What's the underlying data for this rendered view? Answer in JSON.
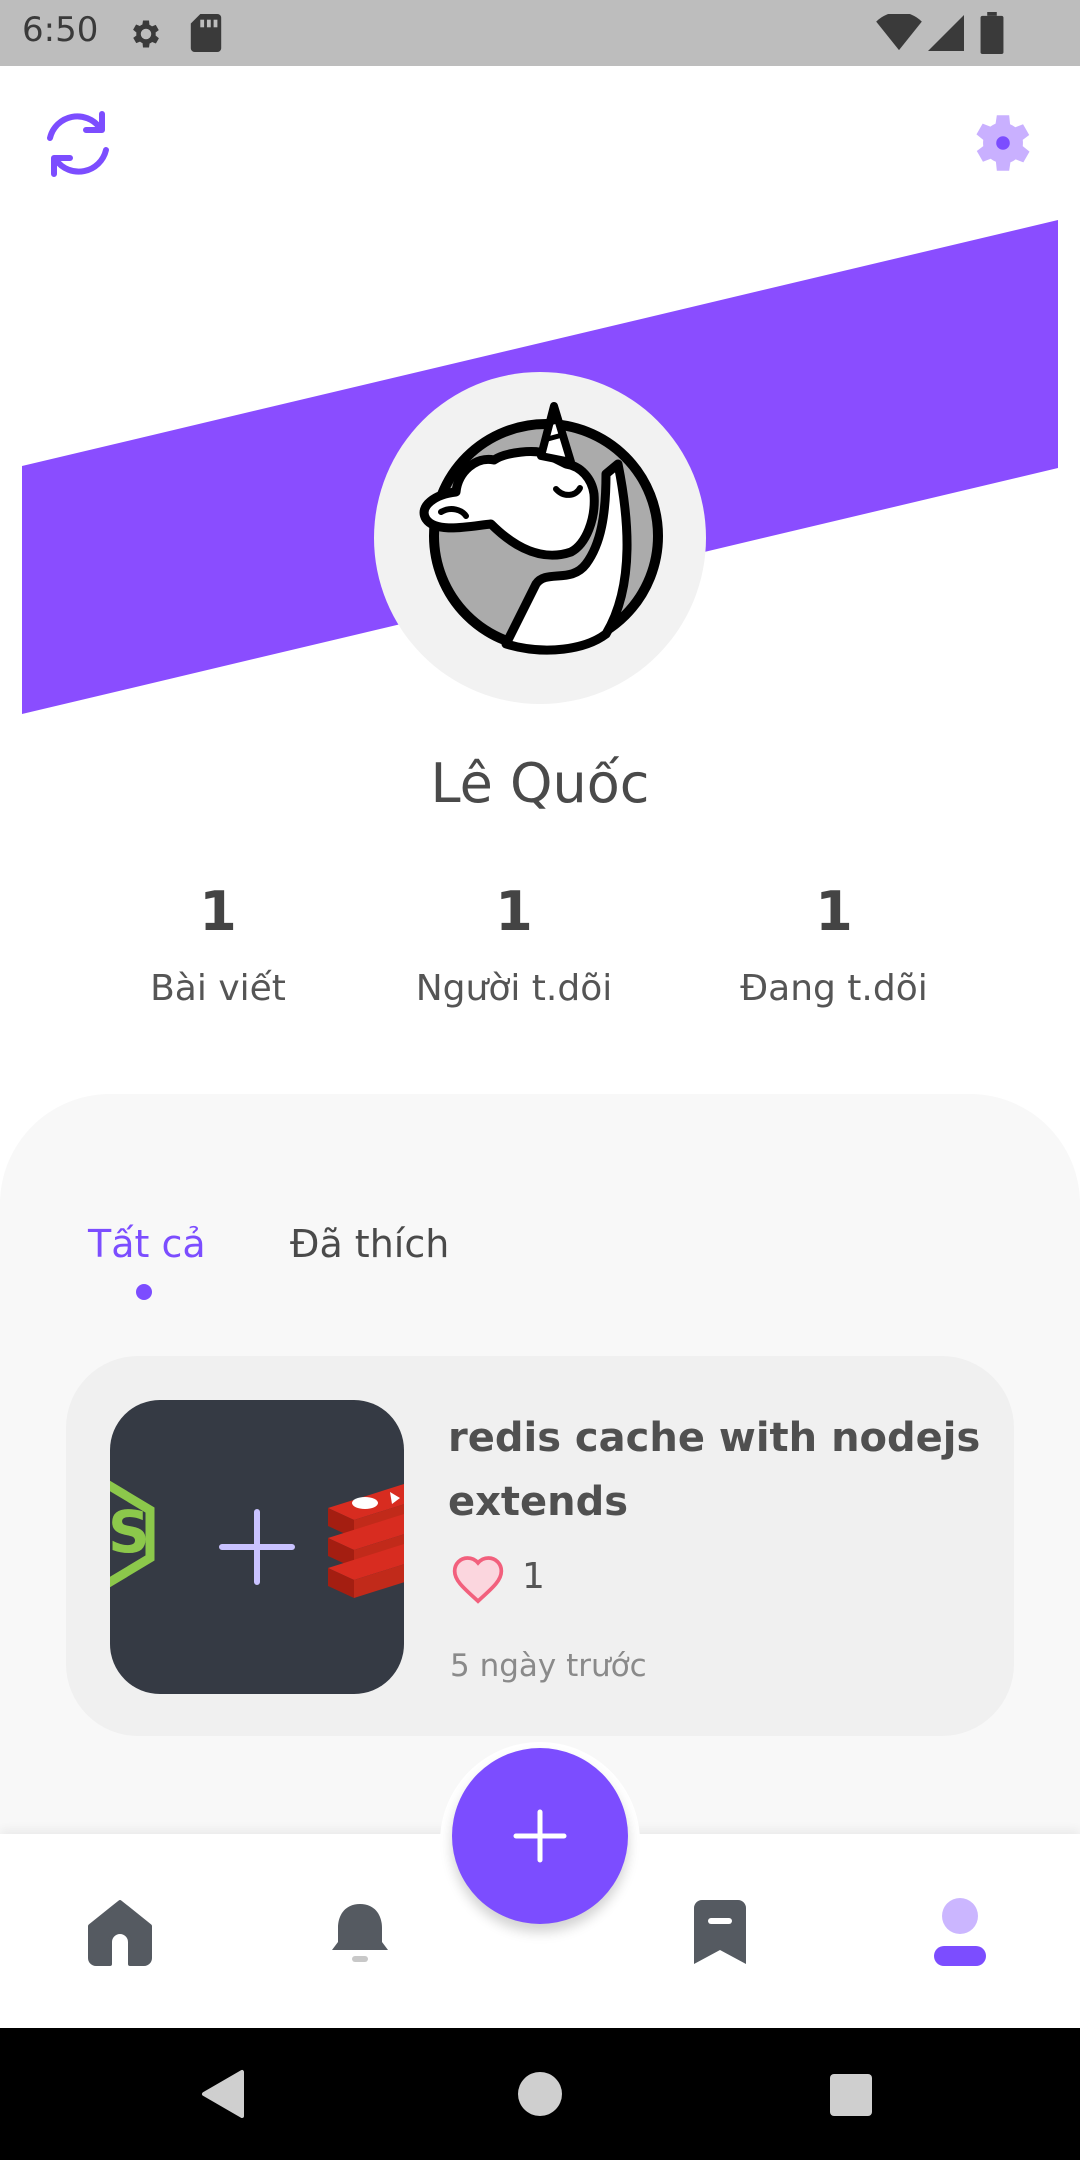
{
  "status_bar": {
    "time": "6:50",
    "icons": [
      "gear-icon",
      "sd-card-icon",
      "wifi-icon",
      "signal-icon",
      "battery-icon"
    ]
  },
  "header": {
    "refresh_icon": "refresh-icon",
    "settings_icon": "gear-icon"
  },
  "colors": {
    "accent": "#7c4dff",
    "banner": "#8a4dff",
    "heart": "#f2607d",
    "thumb_bg": "#353a44"
  },
  "profile": {
    "name": "Lê Quốc",
    "stats": [
      {
        "value": "1",
        "label": "Bài viết"
      },
      {
        "value": "1",
        "label": "Người t.dõi"
      },
      {
        "value": "1",
        "label": "Đang t.dõi"
      }
    ]
  },
  "tabs": [
    {
      "label": "Tất cả",
      "active": true
    },
    {
      "label": "Đã thích",
      "active": false
    }
  ],
  "posts": [
    {
      "title": "redis cache with nodejs extends",
      "likes": "1",
      "time": "5 ngày trước"
    }
  ],
  "bottom_nav": {
    "items": [
      "home-icon",
      "bell-icon",
      "bookmark-icon",
      "profile-icon"
    ],
    "active": "profile-icon",
    "fab_icon": "plus-icon"
  },
  "system_nav": [
    "back-icon",
    "home-circle-icon",
    "recents-icon"
  ]
}
